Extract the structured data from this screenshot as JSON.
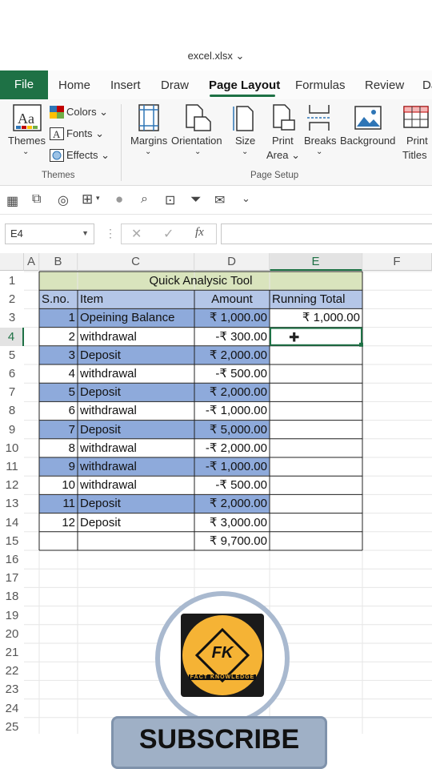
{
  "window": {
    "title": "excel.xlsx ⌄"
  },
  "tabs": [
    "File",
    "Home",
    "Insert",
    "Draw",
    "Page Layout",
    "Formulas",
    "Review",
    "Da"
  ],
  "ribbon": {
    "themes": {
      "label": "Themes",
      "colors": "Colors ⌄",
      "fonts": "Fonts ⌄",
      "effects": "Effects ⌄",
      "group": "Themes"
    },
    "page_setup": {
      "margins": "Margins",
      "orientation": "Orientation",
      "size": "Size",
      "print_area_1": "Print",
      "print_area_2": "Area ⌄",
      "breaks": "Breaks",
      "background": "Background",
      "print_titles_1": "Print",
      "print_titles_2": "Titles",
      "group": "Page Setup"
    }
  },
  "formula_bar": {
    "name_box": "E4",
    "fx": "fx"
  },
  "sheet": {
    "columns": [
      "A",
      "B",
      "C",
      "D",
      "E",
      "F"
    ],
    "rows": [
      "1",
      "2",
      "3",
      "4",
      "5",
      "6",
      "7",
      "8",
      "9",
      "10",
      "11",
      "12",
      "13",
      "14",
      "15",
      "16",
      "17",
      "18",
      "19",
      "20",
      "21",
      "22",
      "23",
      "24",
      "25"
    ],
    "title": "Quick Analysic Tool",
    "headers": {
      "sno": "S.no.",
      "item": "Item",
      "amount": "Amount",
      "running": "Running Total"
    },
    "data": [
      {
        "sno": "1",
        "item": "Opeining Balance",
        "amount": "₹ 1,000.00",
        "running": "₹ 1,000.00"
      },
      {
        "sno": "2",
        "item": "withdrawal",
        "amount": "-₹ 300.00",
        "running": ""
      },
      {
        "sno": "3",
        "item": "Deposit",
        "amount": "₹ 2,000.00",
        "running": ""
      },
      {
        "sno": "4",
        "item": "withdrawal",
        "amount": "-₹ 500.00",
        "running": ""
      },
      {
        "sno": "5",
        "item": "Deposit",
        "amount": "₹ 2,000.00",
        "running": ""
      },
      {
        "sno": "6",
        "item": "withdrawal",
        "amount": "-₹ 1,000.00",
        "running": ""
      },
      {
        "sno": "7",
        "item": "Deposit",
        "amount": "₹ 5,000.00",
        "running": ""
      },
      {
        "sno": "8",
        "item": "withdrawal",
        "amount": "-₹ 2,000.00",
        "running": ""
      },
      {
        "sno": "9",
        "item": "withdrawal",
        "amount": "-₹ 1,000.00",
        "running": ""
      },
      {
        "sno": "10",
        "item": "withdrawal",
        "amount": "-₹ 500.00",
        "running": ""
      },
      {
        "sno": "11",
        "item": "Deposit",
        "amount": "₹ 2,000.00",
        "running": ""
      },
      {
        "sno": "12",
        "item": "Deposit",
        "amount": "₹ 3,000.00",
        "running": ""
      }
    ],
    "total": "₹ 9,700.00"
  },
  "overlay": {
    "logo_line1": "FK",
    "logo_line2": "FACT KNOWLEDGE",
    "subscribe": "SUBSCRIBE"
  },
  "colors": {
    "green": "#1e7145",
    "title_fill": "#d9e4bd",
    "header_fill": "#b4c6e7",
    "band_fill": "#8eaadb"
  }
}
